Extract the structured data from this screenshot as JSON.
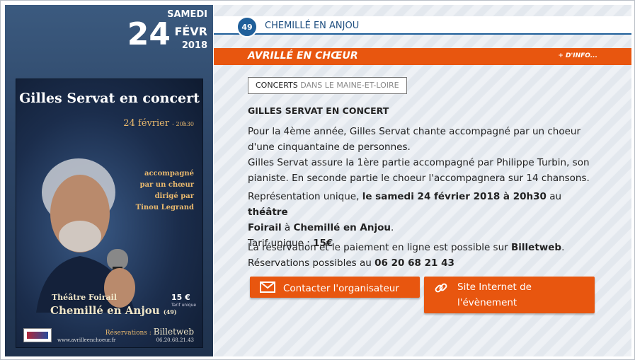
{
  "date": {
    "weekday": "SAMEDI",
    "day": "24",
    "month": "FÉVR",
    "year": "2018"
  },
  "poster": {
    "title": "Gilles Servat en concert",
    "date": "24 février",
    "time": "- 20h30",
    "desc_lines": [
      "accompagné",
      "par un chœur",
      "dirigé par",
      "Tinou Legrand"
    ],
    "venue": "Théâtre Foirail",
    "city": "Chemillé en Anjou",
    "dept": "(49)",
    "price": "15 €",
    "price_sub": "Tarif unique",
    "resa_label": "Réservations :",
    "resa_name": "Billetweb",
    "site": "www.avrilleenchoeur.fr",
    "phone": "06.20.68.21.43"
  },
  "location": {
    "dept_badge": "49",
    "name": "CHEMILLÉ EN ANJOU"
  },
  "header": {
    "organizer": "AVRILLÉ EN CHŒUR",
    "more_info": "+ D'INFO..."
  },
  "category": {
    "main": "CONCERTS",
    "sub": " DANS LE MAINE-ET-LOIRE"
  },
  "event": {
    "title": "GILLES SERVAT EN CONCERT",
    "p1_line1": "Pour la 4ème année, Gilles Servat chante accompagné par un choeur",
    "p1_line2": "d'une cinquantaine de personnes.",
    "p1_line3": "Gilles Servat assure la 1ère partie accompagné par Philippe Turbin, son",
    "p1_line4": "pianiste. En seconde partie le choeur l'accompagnera sur 14 chansons.",
    "p2_a": "Représentation unique, ",
    "p2_b": "le samedi 24 février 2018 à 20h30",
    "p2_c": " au ",
    "p2_d": "théâtre",
    "p2_e": "Foirail",
    "p2_f": " à ",
    "p2_g": "Chemillé en Anjou",
    "p2_h": ".",
    "p2_tarif_label": "Tarif unique : ",
    "p2_tarif_value": "15€",
    "p3_a": "La réservation et le paiement en ligne est possible sur ",
    "p3_b": "Billetweb",
    "p3_c": ".",
    "p3_d": "Réservations possibles au ",
    "p3_e": "06 20 68 21 43"
  },
  "buttons": {
    "contact": "Contacter l'organisateur",
    "site_line1": "Site Internet de",
    "site_line2": "l'évènement"
  },
  "colors": {
    "orange": "#e8560f",
    "blue": "#1f5f9a",
    "navy": "#2d4566"
  },
  "icons": {
    "contact": "envelope-icon",
    "site": "link-icon"
  }
}
